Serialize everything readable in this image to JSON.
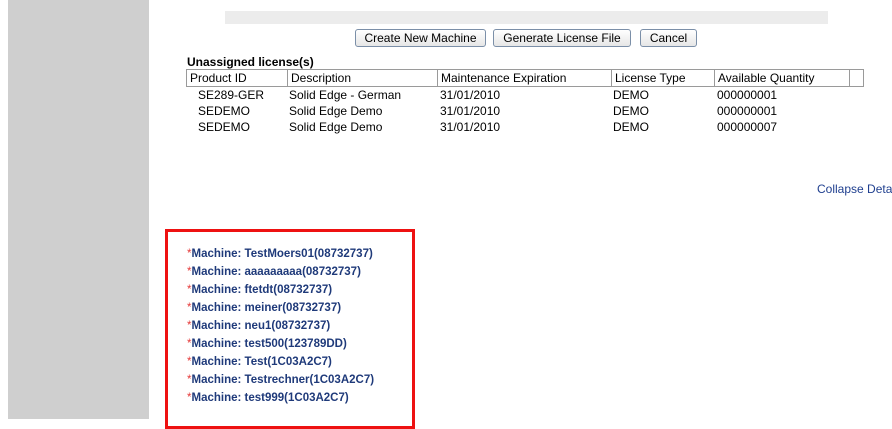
{
  "toolbar": {
    "create_label": "Create New Machine",
    "generate_label": "Generate License File",
    "cancel_label": "Cancel"
  },
  "unassigned": {
    "title": "Unassigned license(s)",
    "columns": [
      "Product ID",
      "Description",
      "Maintenance Expiration",
      "License Type",
      "Available Quantity"
    ],
    "rows": [
      {
        "product_id": "SE289-GER",
        "description": "Solid Edge - German",
        "maintenance": "31/01/2010",
        "type": "DEMO",
        "quantity": "000000001"
      },
      {
        "product_id": "SEDEMO",
        "description": "Solid Edge Demo",
        "maintenance": "31/01/2010",
        "type": "DEMO",
        "quantity": "000000001"
      },
      {
        "product_id": "SEDEMO",
        "description": "Solid Edge Demo",
        "maintenance": "31/01/2010",
        "type": "DEMO",
        "quantity": "000000007"
      }
    ]
  },
  "collapse_label": "Collapse Deta",
  "machines": {
    "asterisk": "*",
    "items": [
      "Machine: TestMoers01(08732737)",
      "Machine: aaaaaaaaa(08732737)",
      "Machine: ftetdt(08732737)",
      "Machine: meiner(08732737)",
      "Machine: neu1(08732737)",
      "Machine: test500(123789DD)",
      "Machine: Test(1C03A2C7)",
      "Machine: Testrechner(1C03A2C7)",
      "Machine: test999(1C03A2C7)"
    ]
  },
  "colors": {
    "highlight_border": "#ee1111",
    "machine_text": "#1f3a7a",
    "asterisk": "#e53b3b",
    "link": "#1f3f8f"
  }
}
